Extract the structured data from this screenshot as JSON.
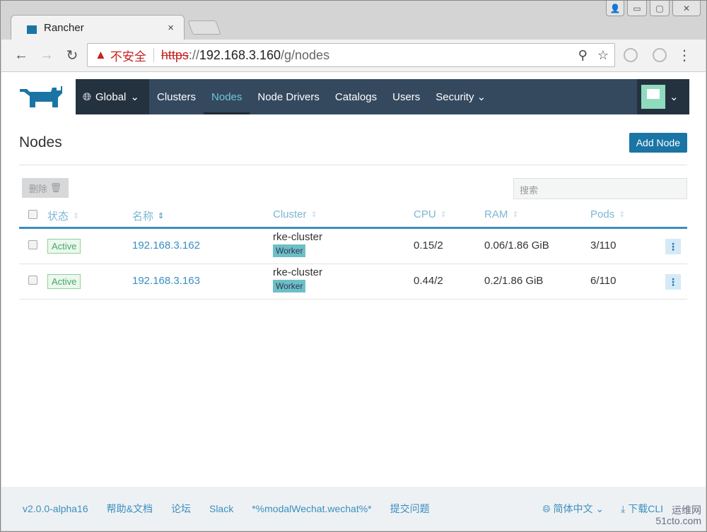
{
  "browser": {
    "tab_title": "Rancher",
    "tab_close": "×",
    "insecure_label": "不安全",
    "url_scheme": "https",
    "url_sep": "://",
    "url_host": "192.168.3.160",
    "url_path": "/g/nodes",
    "window_buttons": [
      "👤",
      "▭",
      "▢",
      "✕"
    ]
  },
  "nav": {
    "global": "Global",
    "items": [
      "Clusters",
      "Nodes",
      "Node Drivers",
      "Catalogs",
      "Users",
      "Security"
    ],
    "active": "Nodes"
  },
  "page": {
    "title": "Nodes",
    "add_button": "Add Node",
    "delete_button": "删除",
    "search_placeholder": "搜索"
  },
  "table": {
    "headers": [
      "状态",
      "名称",
      "Cluster",
      "CPU",
      "RAM",
      "Pods"
    ],
    "rows": [
      {
        "state": "Active",
        "name": "192.168.3.162",
        "cluster": "rke-cluster",
        "role": "Worker",
        "cpu": "0.15/2",
        "ram": "0.06/1.86 GiB",
        "pods": "3/110"
      },
      {
        "state": "Active",
        "name": "192.168.3.163",
        "cluster": "rke-cluster",
        "role": "Worker",
        "cpu": "0.44/2",
        "ram": "0.2/1.86 GiB",
        "pods": "6/110"
      }
    ]
  },
  "footer": {
    "version": "v2.0.0-alpha16",
    "links": [
      "帮助&文档",
      "论坛",
      "Slack",
      "*%modalWechat.wechat%*",
      "提交问题"
    ],
    "language": "简体中文",
    "download": "下载CLI"
  },
  "watermark": {
    "line1": "运维网",
    "line2": "51cto.com"
  },
  "colors": {
    "nav": "#34495e",
    "accent": "#1a75a5",
    "active": "#6fc6d9"
  }
}
